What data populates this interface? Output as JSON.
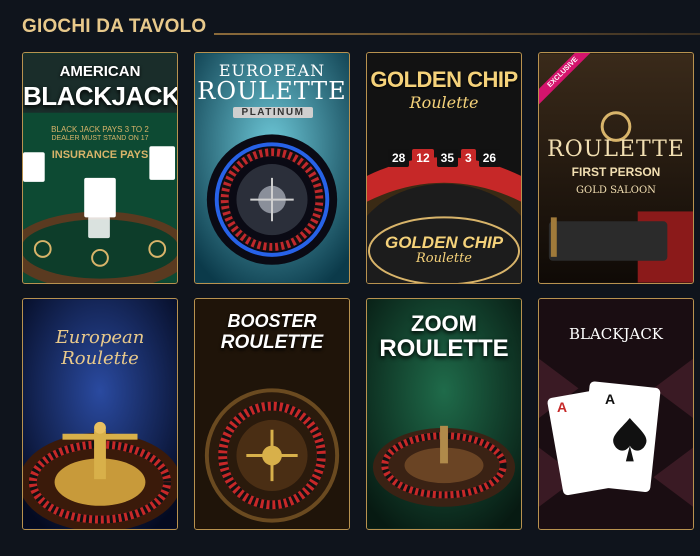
{
  "section": {
    "title": "GIOCHI DA TAVOLO"
  },
  "games": [
    {
      "lines": [
        "AMERICAN",
        "BLACKJACK"
      ],
      "felt_text": [
        "BLACK JACK PAYS 3 TO 2",
        "DEALER MUST STAND ON 17",
        "INSURANCE PAYS"
      ]
    },
    {
      "lines": [
        "EUROPEAN",
        "ROULETTE",
        "PLATINUM"
      ]
    },
    {
      "lines": [
        "GOLDEN CHIP",
        "Roulette",
        "GOLDEN CHIP",
        "Roulette"
      ],
      "numbers": [
        "28",
        "12",
        "35",
        "3",
        "26"
      ]
    },
    {
      "badge": "EXCLUSIVE",
      "lines": [
        "ROULETTE",
        "FIRST PERSON",
        "GOLD SALOON"
      ]
    },
    {
      "lines": [
        "European Roulette"
      ]
    },
    {
      "lines": [
        "BOOSTER",
        "ROULETTE"
      ]
    },
    {
      "lines": [
        "ZOOM",
        "ROULETTE"
      ]
    },
    {
      "lines": [
        "BLACKJACK"
      ],
      "card_ranks": [
        "A",
        "A"
      ]
    }
  ]
}
